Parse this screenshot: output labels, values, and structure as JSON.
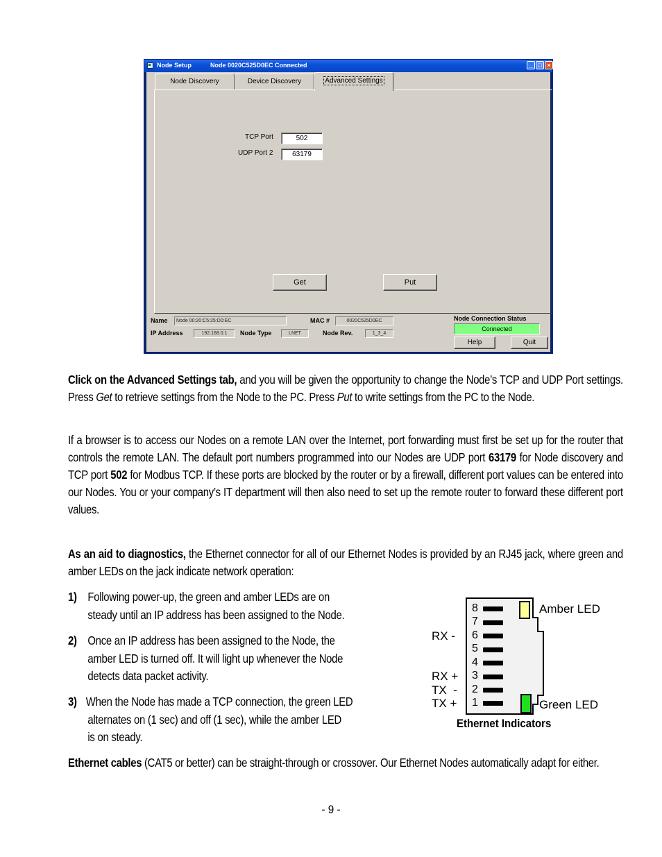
{
  "window": {
    "title": "Node Setup",
    "subtitle": "Node 0020C525D0EC Connected",
    "controls": {
      "minimize": "_",
      "maximize": "□",
      "close": "×"
    },
    "tabs": [
      {
        "label": "Node Discovery",
        "active": false
      },
      {
        "label": "Device Discovery",
        "active": false
      },
      {
        "label": "Advanced Settings",
        "active": true
      }
    ],
    "advanced": {
      "tcp_port_label": "TCP Port",
      "tcp_port_value": "502",
      "udp_port_label": "UDP Port 2",
      "udp_port_value": "63179",
      "get_label": "Get",
      "put_label": "Put"
    },
    "footer": {
      "name_label": "Name",
      "name_value": "Node 00:20:C5:25:D0:EC",
      "mac_label": "MAC #",
      "mac_value": "0020C525D0EC",
      "ip_label": "IP Address",
      "ip_value": "192.168.0.1",
      "type_label": "Node Type",
      "type_value": "LNET",
      "rev_label": "Node Rev.",
      "rev_value": "1_3_4",
      "status_label": "Node Connection Status",
      "status_value": "Connected",
      "status_color": "#80ff80",
      "help_label": "Help",
      "quit_label": "Quit"
    }
  },
  "doc": {
    "p1": {
      "bold": "Click on the Advanced Settings tab,",
      "t1": " and you will be given the opportunity to change the Node’s TCP and UDP Port settings. Press ",
      "i1": "Get",
      "t2": " to retrieve settings from the Node to the PC. Press ",
      "i2": "Put",
      "t3": " to write settings from the PC to the Node."
    },
    "p2": {
      "t1": "If a browser is to access our Nodes on a remote LAN over the Internet, port forwarding must first be set up for the router that controls the remote LAN. The default port numbers programmed into our Nodes are UDP port ",
      "b1": "63179",
      "t2": " for Node discovery and TCP port ",
      "b2": "502",
      "t3": " for Modbus TCP. If these ports are blocked by the router or by a firewall, different port values can be entered into our Nodes. You or your company’s IT department will then also need to set up the remote router to forward these different port values."
    },
    "p3": {
      "bold": "As an aid to diagnostics,",
      "t1": " the Ethernet connector for all of our Ethernet Nodes is provided by an RJ45 jack, where green and amber LEDs on the jack indicate network  operation:"
    },
    "list": [
      {
        "num": "1)",
        "lines": [
          "Following power-up, the green and amber LEDs are on",
          "steady until an IP address has been assigned to the Node."
        ]
      },
      {
        "num": "2)",
        "lines": [
          "Once an IP address has been assigned to the Node, the",
          "amber LED is turned off. It will light up whenever the Node",
          "detects data packet activity."
        ]
      },
      {
        "num": "3)",
        "lines": [
          "When the Node has made a TCP connection, the green LED",
          "alternates on (1 sec) and off (1 sec), while the amber LED",
          "is on steady."
        ]
      }
    ],
    "p4": {
      "bold": "Ethernet cables",
      "t1": " (CAT5 or better) can be straight-through or crossover. Our Ethernet Nodes automatically adapt for either."
    },
    "page_number": "- 9 -"
  },
  "diagram": {
    "caption": "Ethernet Indicators",
    "pins": [
      "8",
      "7",
      "6",
      "5",
      "4",
      "3",
      "2",
      "1"
    ],
    "signal_labels": {
      "rx_minus": "RX -",
      "rx_plus": "RX +",
      "tx_minus": "TX  -",
      "tx_plus": "TX +"
    },
    "amber_label": "Amber LED",
    "green_label": "Green LED",
    "amber_color": "#ffff99",
    "green_color": "#22dd22"
  }
}
